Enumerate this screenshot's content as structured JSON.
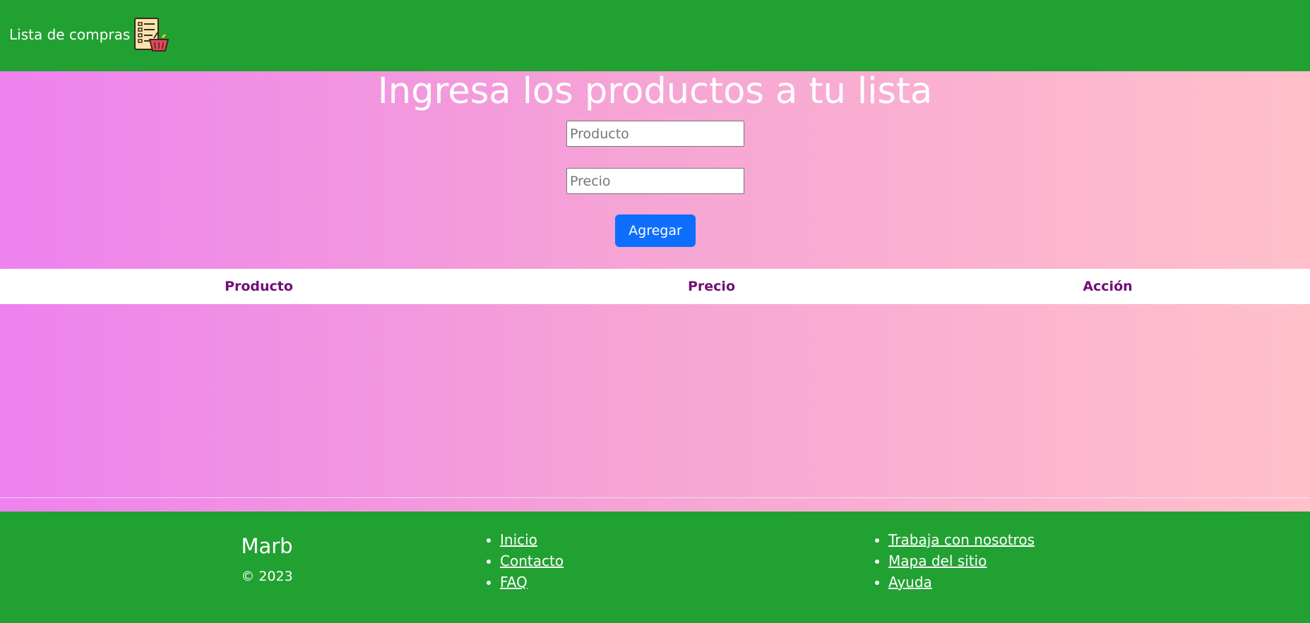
{
  "navbar": {
    "brand_label": "Lista de compras",
    "brand_icon": "shopping-list-basket-icon"
  },
  "form": {
    "title": "Ingresa los productos a tu lista",
    "product_placeholder": "Producto",
    "price_placeholder": "Precio",
    "add_button_label": "Agregar"
  },
  "table": {
    "headers": [
      "Producto",
      "Precio",
      "Acción"
    ],
    "rows": []
  },
  "footer": {
    "name": "Marb",
    "copyright": "© 2023",
    "links_col1": [
      "Inicio",
      "Contacto",
      "FAQ"
    ],
    "links_col2": [
      "Trabaja con nosotros",
      "Mapa del sitio",
      "Ayuda"
    ]
  },
  "colors": {
    "header_green": "#21a131",
    "gradient_start": "#ee82ee",
    "gradient_end": "#ffc0cb",
    "button_blue": "#0d6efd",
    "table_header_text": "#700e78"
  }
}
